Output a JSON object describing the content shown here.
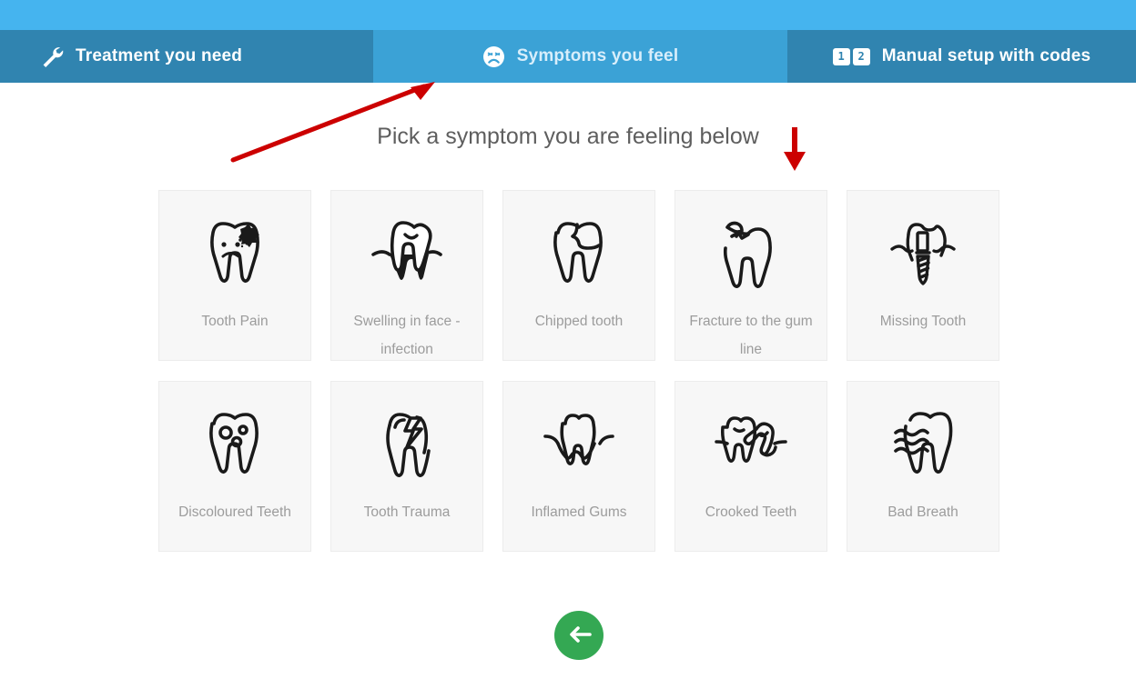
{
  "header": {
    "tabs": [
      {
        "label": "Treatment you need",
        "icon": "wrench-icon",
        "active": false
      },
      {
        "label": "Symptoms you feel",
        "icon": "sad-face-icon",
        "active": true
      },
      {
        "label": "Manual setup with codes",
        "icon": "number-boxes-icon",
        "active": false
      }
    ],
    "code_boxes": [
      "1",
      "2"
    ],
    "colors": {
      "top_strip": "#45b4ef",
      "tab_inactive": "#3084b0",
      "tab_active": "#3ba2d6",
      "tab_text": "#ffffff",
      "tab_text_active": "#d8eefb"
    }
  },
  "main": {
    "heading": "Pick a symptom you are feeling below",
    "symptoms": [
      {
        "label": "Tooth Pain",
        "icon": "tooth-decay-sad-icon"
      },
      {
        "label": "Swelling in face - infection",
        "icon": "tooth-swollen-gum-icon"
      },
      {
        "label": "Chipped tooth",
        "icon": "tooth-chipped-icon"
      },
      {
        "label": "Fracture to the gum line",
        "icon": "tooth-fracture-icon"
      },
      {
        "label": "Missing Tooth",
        "icon": "tooth-implant-icon"
      },
      {
        "label": "Discoloured Teeth",
        "icon": "tooth-spots-icon"
      },
      {
        "label": "Tooth Trauma",
        "icon": "tooth-lightning-icon"
      },
      {
        "label": "Inflamed Gums",
        "icon": "tooth-gumline-icon"
      },
      {
        "label": "Crooked Teeth",
        "icon": "tooth-crooked-icon"
      },
      {
        "label": "Bad Breath",
        "icon": "tooth-odor-waves-icon"
      }
    ],
    "card_bg": "#f7f7f7",
    "label_color": "#9c9c9c"
  },
  "footer": {
    "back_button": {
      "icon": "arrow-left-icon",
      "color": "#34a853"
    }
  },
  "annotations": [
    {
      "name": "red-arrow-diagonal",
      "color": "#cc0000",
      "points_to": "Symptoms you feel"
    },
    {
      "name": "red-arrow-down",
      "color": "#cc0000",
      "points_to": "symptom grid"
    }
  ]
}
